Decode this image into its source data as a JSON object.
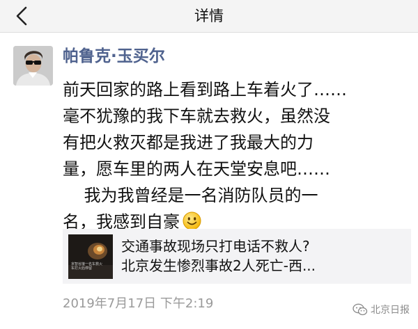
{
  "nav": {
    "title": "详情",
    "back_icon": "chevron-left-icon"
  },
  "post": {
    "author": "帕鲁克·玉买尔",
    "lines": [
      "前天回家的路上看到路上车着火了……",
      "毫不犹豫的我下车就去救火，虽然没",
      "有把火救灭都是我进了我最大的力",
      "量，愿车里的两人在天堂安息吧……",
      "    我为我曾经是一名消防队员的一",
      "名，我感到自豪"
    ],
    "emoji": "smiley-emoji-icon",
    "link_card": {
      "thumbnail_caption_1": "京智谷接一名车救火",
      "thumbnail_caption_2": "车打火后停留",
      "title_line_1": "交通事故现场只打电话不救人?",
      "title_line_2": "北京发生惨烈事故2人死亡-西..."
    },
    "timestamp": "2019年7月17日 下午2:19"
  },
  "watermark": {
    "text": "北京日报"
  }
}
